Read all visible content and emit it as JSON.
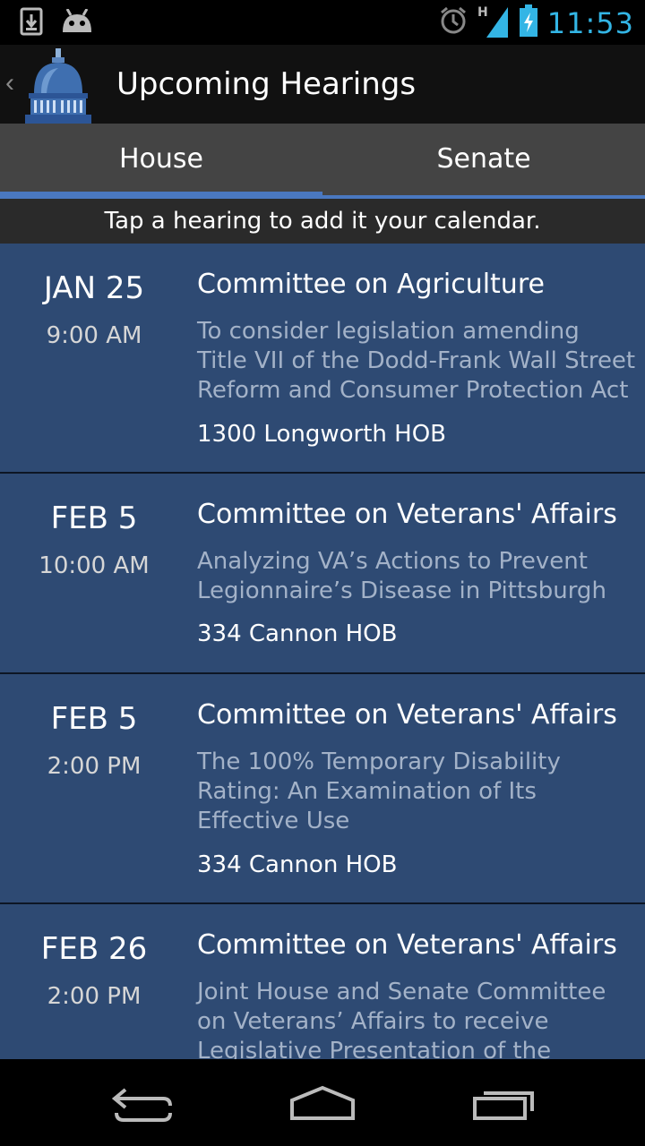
{
  "status_bar": {
    "time": "11:53",
    "network_type": "H",
    "icons": [
      "download-notification-icon",
      "android-notification-icon",
      "alarm-icon",
      "signal-icon",
      "battery-charging-icon"
    ],
    "accent_color": "#33b5e5"
  },
  "action_bar": {
    "title": "Upcoming Hearings",
    "logo": "capitol-dome-logo",
    "up_icon": "chevron-left-icon"
  },
  "tabs": [
    {
      "label": "House",
      "selected": true
    },
    {
      "label": "Senate",
      "selected": false
    }
  ],
  "hint": "Tap a hearing to add it your calendar.",
  "hearings": [
    {
      "date": "JAN 25",
      "time": "9:00 AM",
      "committee": "Committee on Agriculture",
      "description": "To consider legislation amending Title VII of the Dodd-Frank Wall Street Reform and Consumer Protection Act",
      "room": "1300 Longworth HOB"
    },
    {
      "date": "FEB 5",
      "time": "10:00 AM",
      "committee": "Committee on Veterans' Affairs",
      "description": "Analyzing VA’s Actions to Prevent Legionnaire’s Disease in Pittsburgh",
      "room": "334 Cannon HOB"
    },
    {
      "date": "FEB 5",
      "time": "2:00 PM",
      "committee": "Committee on Veterans' Affairs",
      "description": "The 100% Temporary Disability Rating: An Examination of Its Effective Use",
      "room": "334 Cannon HOB"
    },
    {
      "date": "FEB 26",
      "time": "2:00 PM",
      "committee": "Committee on Veterans' Affairs",
      "description": "Joint House and Senate Committee on Veterans’ Affairs to receive Legislative Presentation of the",
      "room": ""
    }
  ],
  "nav_bar": {
    "buttons": [
      "back-icon",
      "home-icon",
      "recent-apps-icon"
    ]
  },
  "colors": {
    "list_background": "#2e4a73",
    "tab_indicator": "#4a78c0",
    "description_text": "#a3b2c8"
  }
}
